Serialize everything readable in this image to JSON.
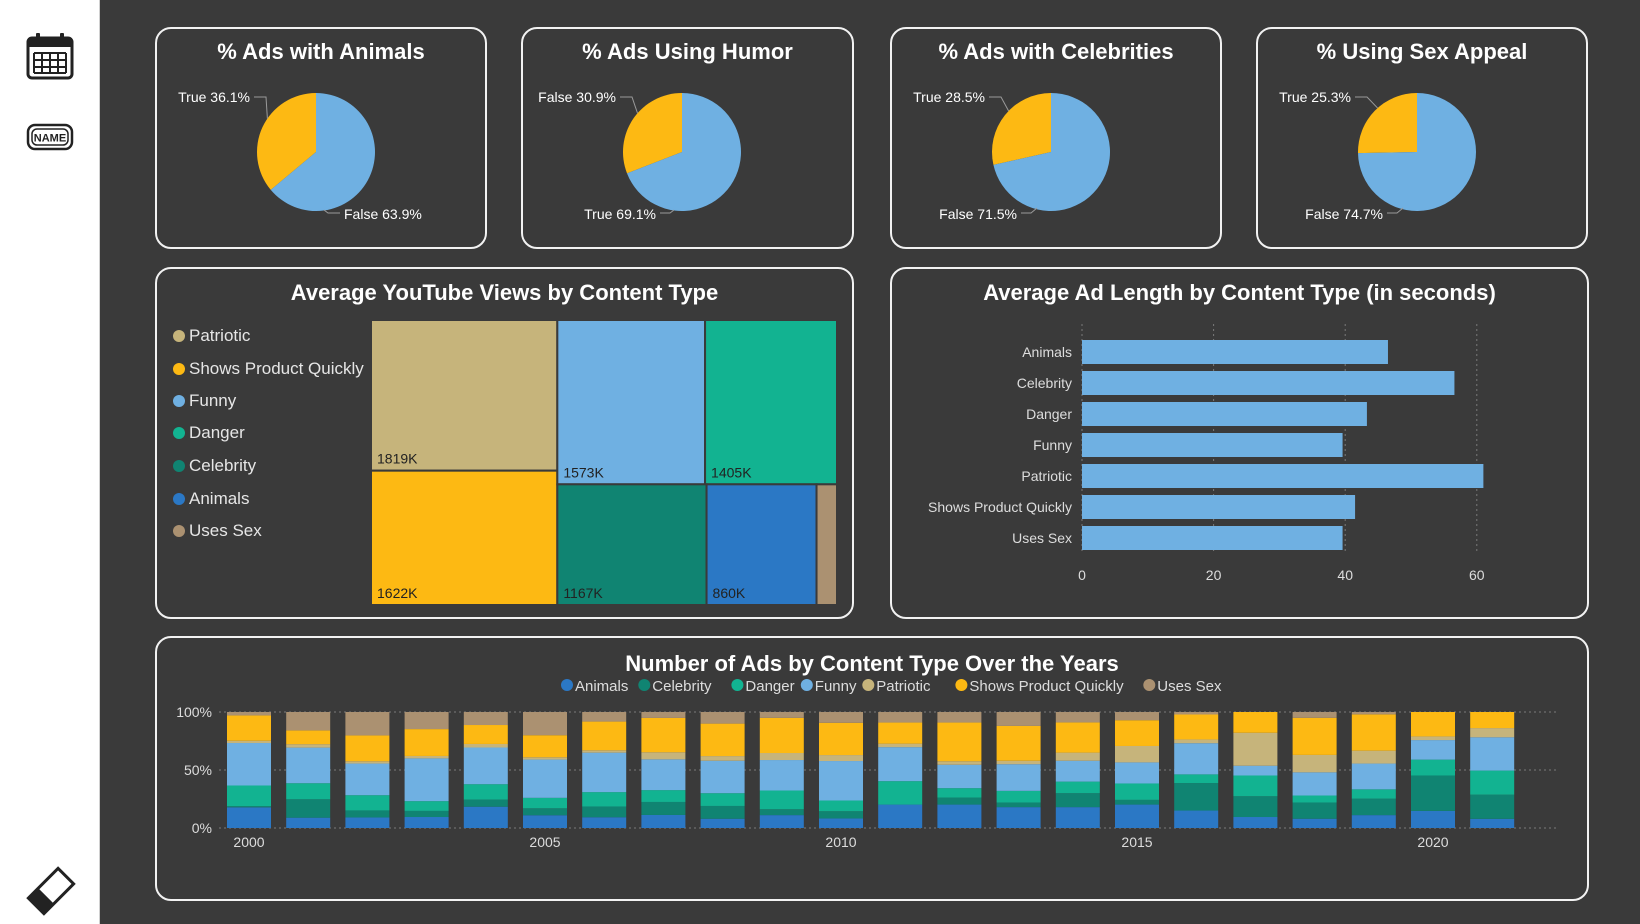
{
  "colors": {
    "background": "#3a3a3a",
    "card_border": "#f2f2f2",
    "true_or_false_yellow": "#fdb913",
    "blue_light": "#6fb0e2",
    "animals": "#2b78c5",
    "celebrity": "#108472",
    "danger": "#12b391",
    "funny": "#6fb0e2",
    "patriotic": "#c6b47b",
    "shows_product_quickly": "#fdb913",
    "uses_sex": "#ab9171"
  },
  "sidebar": {
    "calendar_icon": "calendar-icon",
    "name_icon": "name-tag-icon",
    "name_icon_text": "NAME",
    "eraser_icon": "eraser-icon"
  },
  "pies": [
    {
      "title": "% Ads with Animals",
      "slices": [
        {
          "label": "True 36.1%",
          "value": 36.1,
          "color": "#fdb913"
        },
        {
          "label": "False 63.9%",
          "value": 63.9,
          "color": "#6fb0e2"
        }
      ]
    },
    {
      "title": "% Ads Using Humor",
      "slices": [
        {
          "label": "False 30.9%",
          "value": 30.9,
          "color": "#fdb913"
        },
        {
          "label": "True 69.1%",
          "value": 69.1,
          "color": "#6fb0e2"
        }
      ]
    },
    {
      "title": "% Ads with Celebrities",
      "slices": [
        {
          "label": "True 28.5%",
          "value": 28.5,
          "color": "#fdb913"
        },
        {
          "label": "False 71.5%",
          "value": 71.5,
          "color": "#6fb0e2"
        }
      ]
    },
    {
      "title": "% Using Sex Appeal",
      "slices": [
        {
          "label": "True 25.3%",
          "value": 25.3,
          "color": "#fdb913"
        },
        {
          "label": "False 74.7%",
          "value": 74.7,
          "color": "#6fb0e2"
        }
      ]
    }
  ],
  "treemap": {
    "title": "Average YouTube Views by Content Type",
    "legend": [
      "Patriotic",
      "Shows Product Quickly",
      "Funny",
      "Danger",
      "Celebrity",
      "Animals",
      "Uses Sex"
    ],
    "tiles": [
      {
        "name": "Patriotic",
        "label": "1819K",
        "value": 1819,
        "color": "#c6b47b"
      },
      {
        "name": "Shows Product Quickly",
        "label": "1622K",
        "value": 1622,
        "color": "#fdb913"
      },
      {
        "name": "Funny",
        "label": "1573K",
        "value": 1573,
        "color": "#6fb0e2"
      },
      {
        "name": "Danger",
        "label": "1405K",
        "value": 1405,
        "color": "#12b391"
      },
      {
        "name": "Celebrity",
        "label": "1167K",
        "value": 1167,
        "color": "#108472"
      },
      {
        "name": "Animals",
        "label": "860K",
        "value": 860,
        "color": "#2b78c5"
      },
      {
        "name": "Uses Sex",
        "label": "",
        "value": 160,
        "color": "#ab9171"
      }
    ]
  },
  "chart_data": [
    {
      "type": "pie",
      "title": "% Ads with Animals",
      "categories": [
        "True",
        "False"
      ],
      "values": [
        36.1,
        63.9
      ]
    },
    {
      "type": "pie",
      "title": "% Ads Using Humor",
      "categories": [
        "False",
        "True"
      ],
      "values": [
        30.9,
        69.1
      ]
    },
    {
      "type": "pie",
      "title": "% Ads with Celebrities",
      "categories": [
        "True",
        "False"
      ],
      "values": [
        28.5,
        71.5
      ]
    },
    {
      "type": "pie",
      "title": "% Using Sex Appeal",
      "categories": [
        "True",
        "False"
      ],
      "values": [
        25.3,
        74.7
      ]
    },
    {
      "type": "treemap",
      "title": "Average YouTube Views by Content Type",
      "categories": [
        "Patriotic",
        "Shows Product Quickly",
        "Funny",
        "Danger",
        "Celebrity",
        "Animals",
        "Uses Sex"
      ],
      "values": [
        1819,
        1622,
        1573,
        1405,
        1167,
        860,
        160
      ],
      "legend": "left"
    },
    {
      "type": "bar",
      "orientation": "horizontal",
      "title": "Average Ad Length by Content Type (in seconds)",
      "categories": [
        "Animals",
        "Celebrity",
        "Danger",
        "Funny",
        "Patriotic",
        "Shows Product Quickly",
        "Uses Sex"
      ],
      "values": [
        46.5,
        56.6,
        43.3,
        39.6,
        61,
        41.5,
        39.6
      ],
      "xlim": [
        0,
        62
      ],
      "xticks": [
        0,
        20,
        40,
        60
      ],
      "grid": true,
      "color": "#6fb0e2"
    },
    {
      "type": "bar",
      "stacked": true,
      "percent": true,
      "title": "Number of Ads by Content Type Over the Years",
      "x": [
        2000,
        2001,
        2002,
        2003,
        2004,
        2005,
        2006,
        2007,
        2008,
        2009,
        2010,
        2011,
        2012,
        2013,
        2014,
        2015,
        2016,
        2017,
        2018,
        2019,
        2020,
        2021
      ],
      "xticks": [
        2000,
        2005,
        2010,
        2015,
        2020
      ],
      "yticks": [
        "0%",
        "50%",
        "100%"
      ],
      "legend": "top",
      "series": [
        {
          "name": "Animals",
          "color": "#2b78c5",
          "values": [
            18,
            9,
            9,
            9,
            18,
            11,
            9,
            11,
            8,
            11,
            8,
            20,
            20,
            18,
            18,
            20,
            14,
            9,
            8,
            11,
            14,
            8
          ]
        },
        {
          "name": "Celebrity",
          "color": "#108472",
          "values": [
            1,
            16,
            6,
            5,
            6,
            6,
            9,
            11,
            11,
            5,
            6,
            0,
            6,
            4,
            12,
            4,
            22,
            17,
            14,
            14,
            29,
            21
          ]
        },
        {
          "name": "Danger",
          "color": "#12b391",
          "values": [
            18,
            14,
            13,
            8,
            13,
            9,
            12,
            10,
            11,
            16,
            9,
            20,
            8,
            10,
            10,
            14,
            7,
            17,
            6,
            8,
            13,
            21
          ]
        },
        {
          "name": "Funny",
          "color": "#6fb0e2",
          "values": [
            37,
            31,
            27,
            35,
            31,
            33,
            33,
            26,
            28,
            26,
            33,
            29,
            20,
            23,
            18,
            18,
            25,
            8,
            20,
            22,
            16,
            29
          ]
        },
        {
          "name": "Patriotic",
          "color": "#c6b47b",
          "values": [
            2,
            3,
            2,
            2,
            3,
            2,
            2,
            6,
            4,
            6,
            5,
            3,
            3,
            3,
            7,
            14,
            3,
            27,
            15,
            11,
            3,
            8
          ]
        },
        {
          "name": "Shows Product Quickly",
          "color": "#fdb913",
          "values": [
            22,
            12,
            22,
            22,
            16,
            19,
            24,
            29,
            28,
            30,
            27,
            18,
            33,
            30,
            26,
            22,
            20,
            17,
            32,
            31,
            20,
            14
          ]
        },
        {
          "name": "Uses Sex",
          "color": "#ab9171",
          "values": [
            3,
            16,
            20,
            14,
            11,
            20,
            8,
            5,
            10,
            5,
            9,
            9,
            9,
            12,
            9,
            7,
            2,
            0,
            5,
            2,
            0,
            0
          ]
        }
      ]
    }
  ],
  "bars": {
    "title": "Average Ad Length by Content Type (in seconds)"
  },
  "stacked": {
    "title": "Number of Ads by Content Type Over the Years"
  }
}
